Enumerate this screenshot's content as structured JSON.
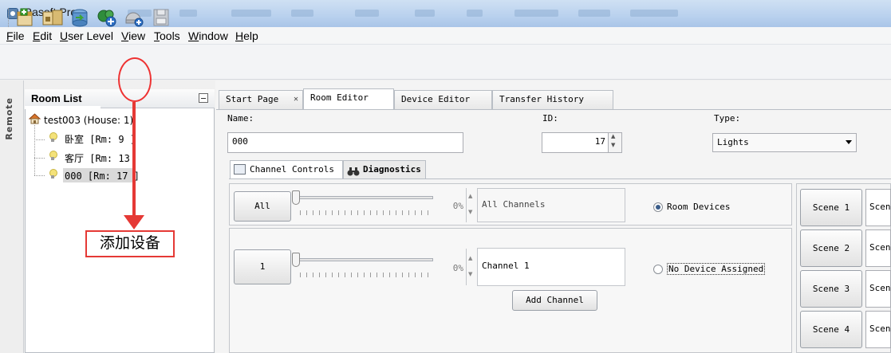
{
  "window": {
    "title": "Rasoft Pro"
  },
  "menu": [
    "File",
    "Edit",
    "User Level",
    "View",
    "Tools",
    "Window",
    "Help"
  ],
  "toolbar": {
    "buttons": [
      {
        "icon": "new-house-icon"
      },
      {
        "icon": "open-folders-icon"
      },
      {
        "icon": "import-icon"
      },
      {
        "icon": "add-room-icon"
      },
      {
        "icon": "add-device-icon"
      },
      {
        "icon": "save-icon"
      }
    ]
  },
  "sidebar": {
    "strip_label": "Remote",
    "title": "Room List",
    "tree": {
      "root": "test003 (House: 1)",
      "rooms": [
        "卧室 [Rm: 9 ]",
        "客厅 [Rm: 13",
        "000 [Rm: 17 ]"
      ]
    }
  },
  "annotation": {
    "label": "添加设备",
    "color": "#e53935"
  },
  "tabs": [
    "Start Page",
    "Room Editor",
    "Device Editor",
    "Transfer History"
  ],
  "editor": {
    "name_label": "Name:",
    "name_value": "000",
    "id_label": "ID:",
    "id_value": "17",
    "type_label": "Type:",
    "type_value": "Lights",
    "subtabs": [
      "Channel Controls",
      "Diagnostics"
    ]
  },
  "channels": {
    "all": {
      "button": "All",
      "percent": "0%",
      "name": "All Channels",
      "option_label": "Room Devices",
      "option_selected": true
    },
    "items": [
      {
        "button": "1",
        "percent": "0%",
        "name": "Channel 1",
        "option_label": "No Device Assigned",
        "option_selected": false
      }
    ],
    "add_button": "Add Channel"
  },
  "scenes": [
    {
      "button": "Scene 1",
      "field": "Scen"
    },
    {
      "button": "Scene 2",
      "field": "Scen"
    },
    {
      "button": "Scene 3",
      "field": "Scen"
    },
    {
      "button": "Scene 4",
      "field": "Scen"
    }
  ]
}
